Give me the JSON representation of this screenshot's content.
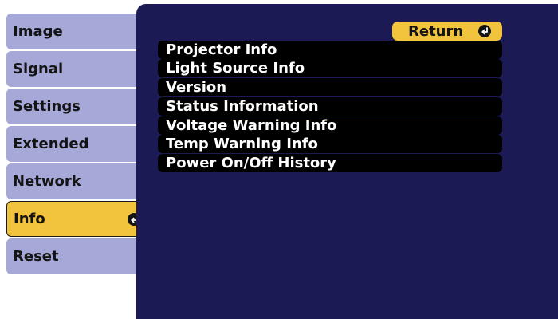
{
  "sidebar": {
    "items": [
      {
        "label": "Image",
        "active": false
      },
      {
        "label": "Signal",
        "active": false
      },
      {
        "label": "Settings",
        "active": false
      },
      {
        "label": "Extended",
        "active": false
      },
      {
        "label": "Network",
        "active": false
      },
      {
        "label": "Info",
        "active": true
      },
      {
        "label": "Reset",
        "active": false
      }
    ]
  },
  "main": {
    "return_label": "Return",
    "menu_items": [
      "Projector Info",
      "Light Source Info",
      "Version",
      "Status Information",
      "Voltage Warning Info",
      "Temp Warning Info",
      "Power On/Off History"
    ]
  },
  "icons": {
    "enter": "enter-icon"
  },
  "colors": {
    "panel_bg": "#1b1a54",
    "tab_bg": "#a6a8d8",
    "highlight": "#f2c33c",
    "menu_item_bg": "#000000",
    "menu_text": "#ffffff"
  }
}
